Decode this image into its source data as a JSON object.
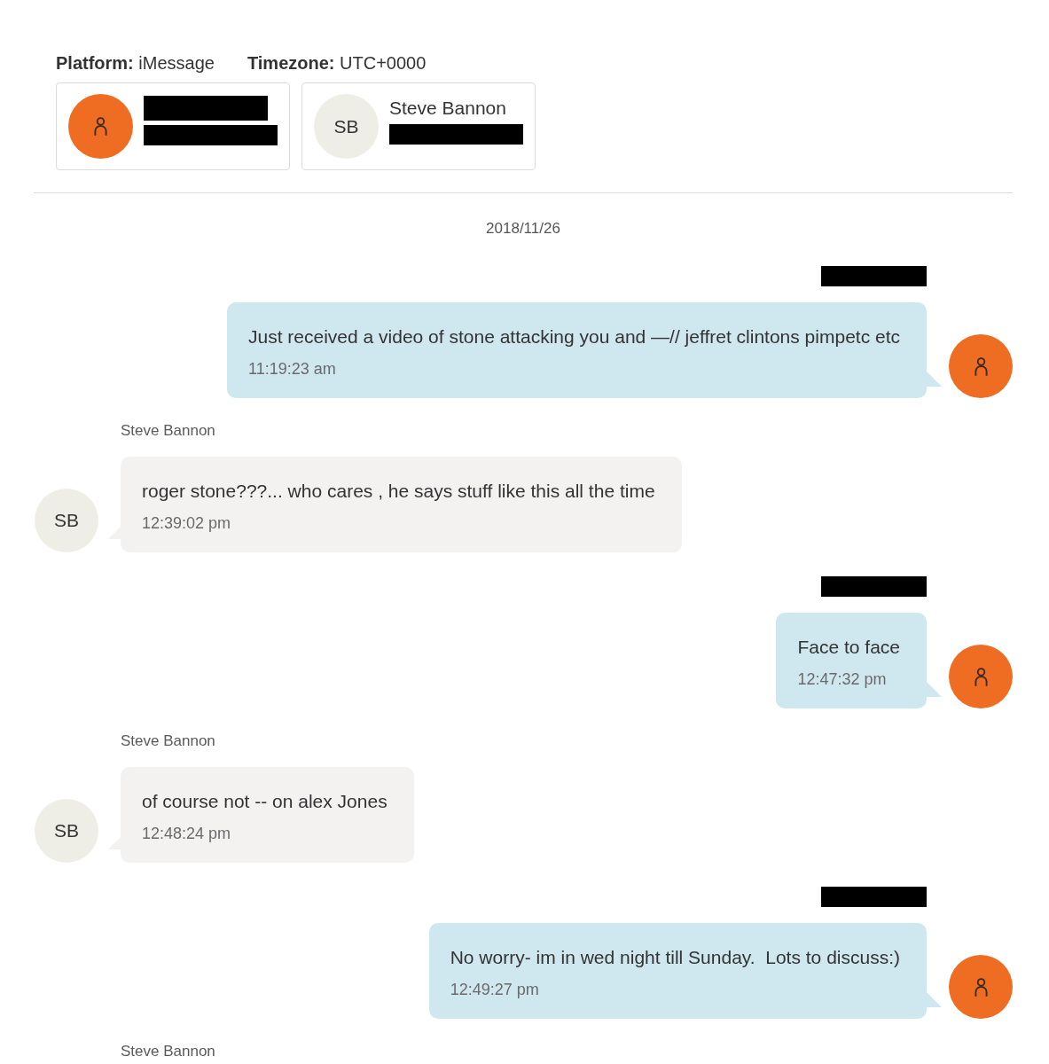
{
  "meta": [
    {
      "label": "Platform:",
      "value": "iMessage"
    },
    {
      "label": "Timezone:",
      "value": "UTC+0000"
    }
  ],
  "participants": [
    {
      "kind": "owner",
      "name_redacted": true,
      "handle_redacted": true
    },
    {
      "kind": "contact",
      "initials": "SB",
      "name": "Steve Bannon",
      "handle_redacted": true
    }
  ],
  "date": "2018/11/26",
  "messages": [
    {
      "kind": "outgoing",
      "sender_redacted": true,
      "text": "Just received a video of stone attacking you and —// jeffret clintons pimpetc etc",
      "time": "11:19:23 am"
    },
    {
      "kind": "incoming",
      "sender": "Steve Bannon",
      "initials": "SB",
      "text": "roger stone???... who cares , he says stuff like this all the time",
      "time": "12:39:02 pm"
    },
    {
      "kind": "outgoing",
      "sender_redacted": true,
      "text": "Face to face",
      "time": "12:47:32 pm"
    },
    {
      "kind": "incoming",
      "sender": "Steve Bannon",
      "initials": "SB",
      "text": "of course not -- on alex Jones",
      "time": "12:48:24 pm"
    },
    {
      "kind": "outgoing",
      "sender_redacted": true,
      "text": "No worry- im in wed night till Sunday.  Lots to discuss:)",
      "time": "12:49:27 pm"
    },
    {
      "kind": "incoming",
      "sender": "Steve Bannon"
    }
  ]
}
